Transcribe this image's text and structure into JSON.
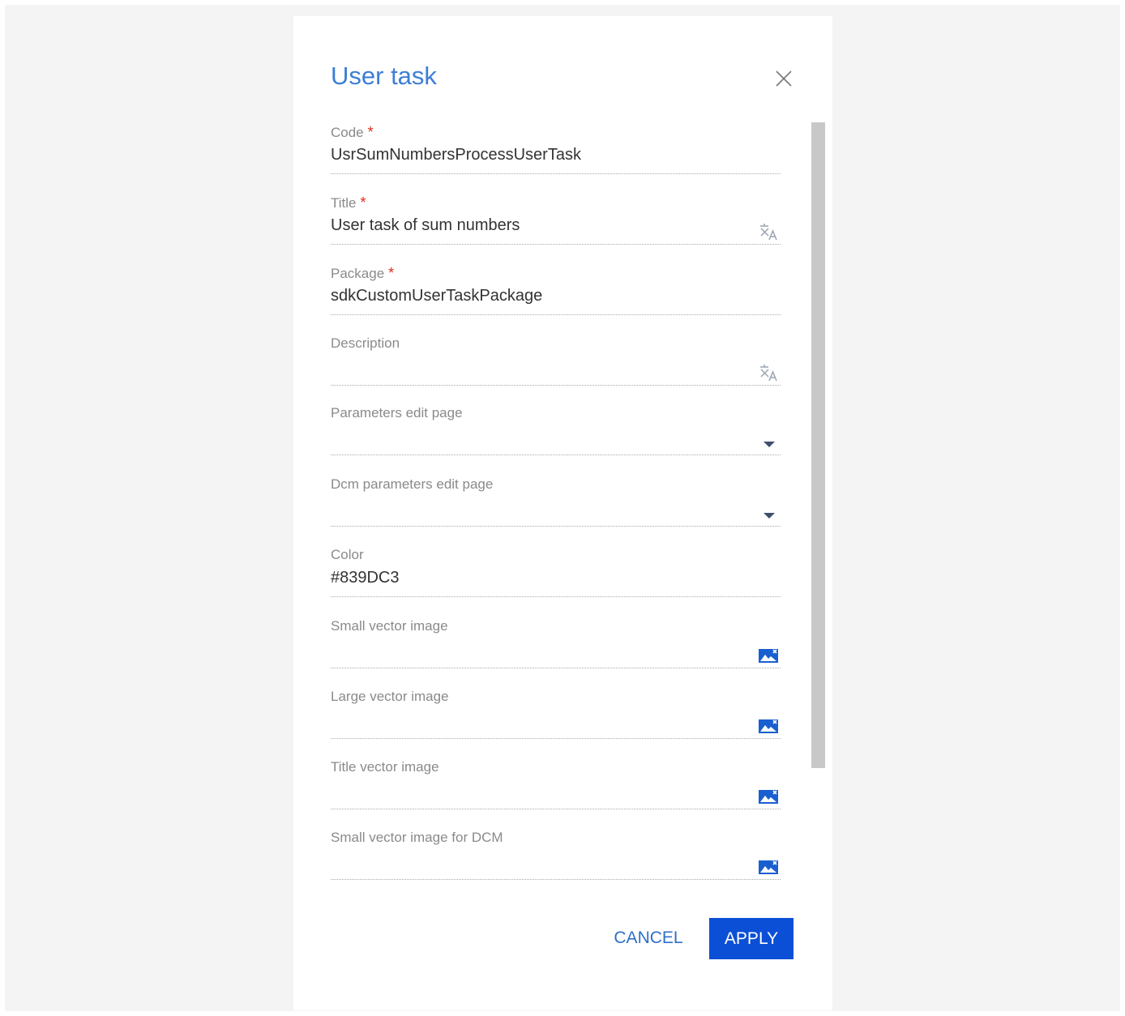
{
  "dialog": {
    "title": "User task",
    "close_icon": "close-icon",
    "buttons": {
      "cancel": "CANCEL",
      "apply": "APPLY"
    }
  },
  "fields": {
    "code": {
      "label": "Code",
      "required_mark": "*",
      "value": "UsrSumNumbersProcessUserTask"
    },
    "title": {
      "label": "Title",
      "required_mark": "*",
      "value": "User task of sum numbers",
      "icon": "translate-icon"
    },
    "package": {
      "label": "Package",
      "required_mark": "*",
      "value": "sdkCustomUserTaskPackage"
    },
    "description": {
      "label": "Description",
      "value": "",
      "icon": "translate-icon"
    },
    "parameters_edit_page": {
      "label": "Parameters edit page",
      "value": "",
      "icon": "dropdown-arrow-icon"
    },
    "dcm_parameters_edit_page": {
      "label": "Dcm parameters edit page",
      "value": "",
      "icon": "dropdown-arrow-icon"
    },
    "color": {
      "label": "Color",
      "value": "#839DC3"
    },
    "small_vector_image": {
      "label": "Small vector image",
      "icon": "image-upload-icon"
    },
    "large_vector_image": {
      "label": "Large vector image",
      "icon": "image-upload-icon"
    },
    "title_vector_image": {
      "label": "Title vector image",
      "icon": "image-upload-icon"
    },
    "small_vector_image_dcm": {
      "label": "Small vector image for DCM",
      "icon": "image-upload-icon"
    }
  },
  "colors": {
    "title": "#3d7ed6",
    "required": "#e0281a",
    "primary_button": "#0a4fd6",
    "link_button": "#2f6fc7",
    "icon_blue": "#1a5fd0",
    "scrollbar": "#c8c8c8"
  }
}
